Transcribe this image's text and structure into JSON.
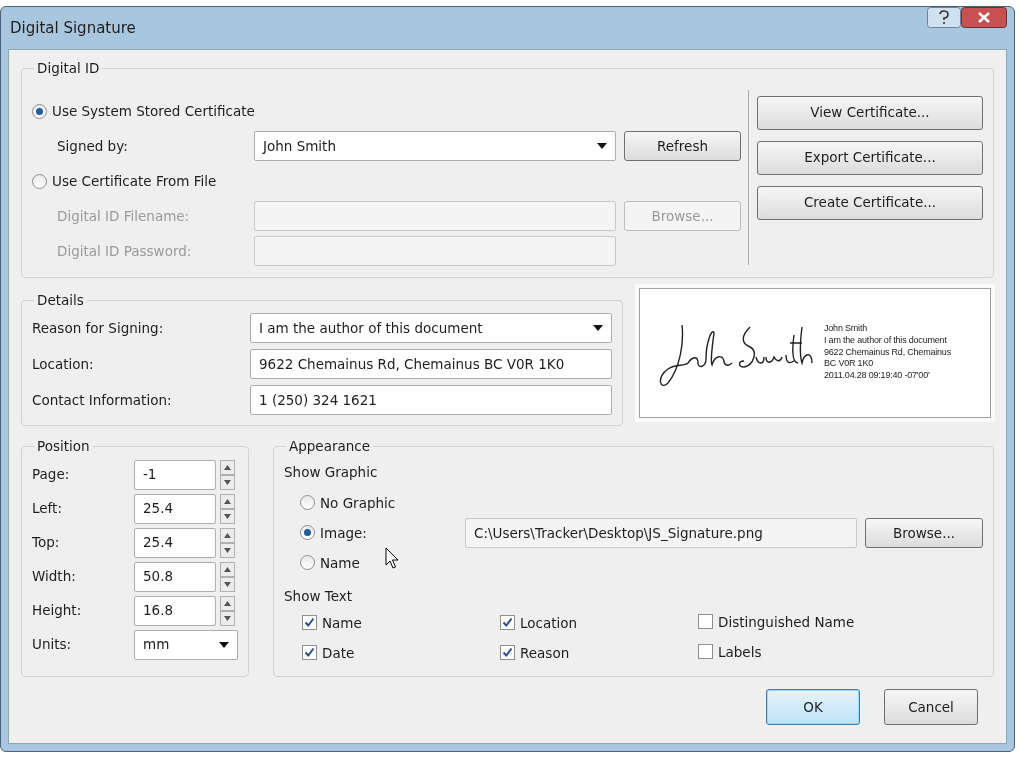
{
  "window": {
    "title": "Digital Signature"
  },
  "digital_id": {
    "title": "Digital ID",
    "source_options": [
      {
        "label": "Use System Stored Certificate",
        "selected": true
      },
      {
        "label": "Use Certificate From File",
        "selected": false
      }
    ],
    "signed_by": {
      "label": "Signed by:",
      "value": "John Smith"
    },
    "refresh_button": "Refresh",
    "filename": {
      "label": "Digital ID Filename:",
      "disabled": true
    },
    "browse_button": {
      "label": "Browse...",
      "disabled": true
    },
    "password": {
      "label": "Digital ID Password:",
      "disabled": true
    },
    "certificate_buttons": [
      "View Certificate...",
      "Export Certificate...",
      "Create Certificate..."
    ]
  },
  "details": {
    "title": "Details",
    "fields": [
      {
        "label": "Reason for Signing:",
        "value": "I am the author of this document",
        "kind": "dropdown"
      },
      {
        "label": "Location:",
        "value": "9622 Chemainus Rd, Chemainus BC V0R 1K0",
        "kind": "text"
      },
      {
        "label": "Contact Information:",
        "value": "1 (250) 324 1621",
        "kind": "text"
      }
    ]
  },
  "preview": {
    "lines": [
      "John Smith",
      "I am the author of this document",
      "9622 Chemainus Rd, Chemainus",
      "BC V0R 1K0",
      "2011.04.28 09:19:40 -07'00'"
    ]
  },
  "position": {
    "title": "Position",
    "fields": [
      {
        "label": "Page:",
        "value": "-1",
        "kind": "spin"
      },
      {
        "label": "Left:",
        "value": "25.4",
        "kind": "spin"
      },
      {
        "label": "Top:",
        "value": "25.4",
        "kind": "spin"
      },
      {
        "label": "Width:",
        "value": "50.8",
        "kind": "spin"
      },
      {
        "label": "Height:",
        "value": "16.8",
        "kind": "spin"
      },
      {
        "label": "Units:",
        "value": "mm",
        "kind": "dropdown"
      }
    ]
  },
  "appearance": {
    "title": "Appearance",
    "graphic_title": "Show Graphic",
    "graphic_options": [
      {
        "label": "No Graphic",
        "selected": false
      },
      {
        "label": "Image:",
        "selected": true
      },
      {
        "label": "Name",
        "selected": false
      }
    ],
    "image_path": "C:\\Users\\Tracker\\Desktop\\JS_Signature.png",
    "browse_button": "Browse...",
    "text_title": "Show Text",
    "text_options": [
      {
        "label": "Name",
        "checked": true
      },
      {
        "label": "Date",
        "checked": true
      },
      {
        "label": "Location",
        "checked": true
      },
      {
        "label": "Reason",
        "checked": true
      },
      {
        "label": "Distinguished Name",
        "checked": false
      },
      {
        "label": "Labels",
        "checked": false
      }
    ]
  },
  "buttons": [
    {
      "label": "OK",
      "default": true
    },
    {
      "label": "Cancel",
      "default": false
    }
  ]
}
